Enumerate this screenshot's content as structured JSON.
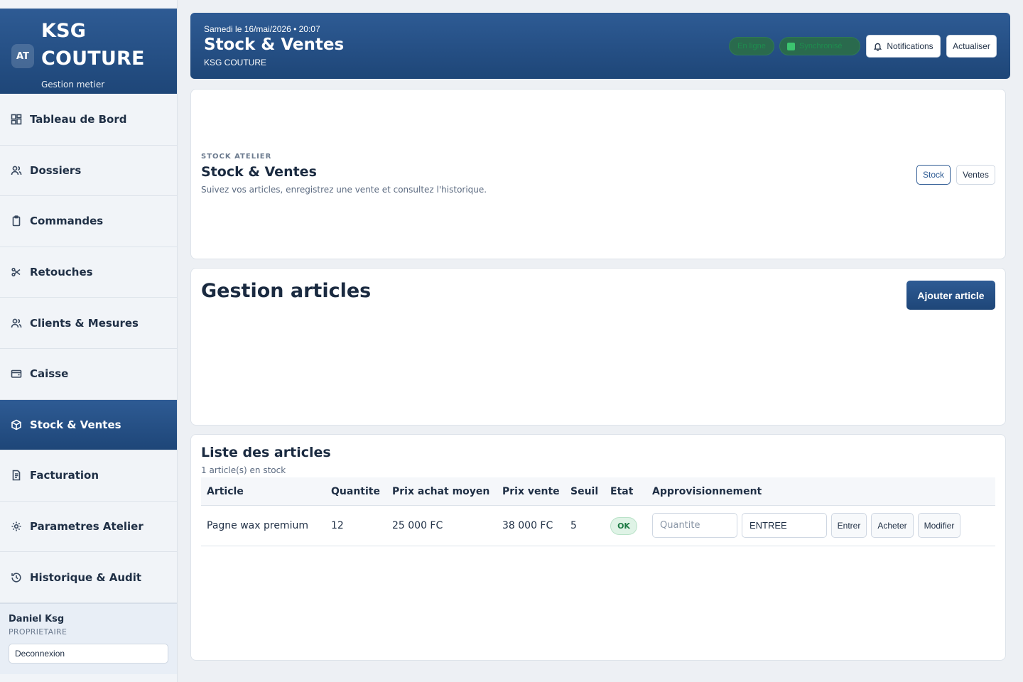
{
  "brand": {
    "badge": "AT",
    "title": "KSG COUTURE",
    "subtitle": "Gestion metier"
  },
  "nav": [
    {
      "label": "Tableau de Bord",
      "icon": "dashboard-icon"
    },
    {
      "label": "Dossiers",
      "icon": "users-icon"
    },
    {
      "label": "Commandes",
      "icon": "clipboard-icon"
    },
    {
      "label": "Retouches",
      "icon": "scissors-icon"
    },
    {
      "label": "Clients & Mesures",
      "icon": "users-icon"
    },
    {
      "label": "Caisse",
      "icon": "wallet-icon"
    },
    {
      "label": "Stock & Ventes",
      "icon": "box-icon",
      "active": true
    },
    {
      "label": "Facturation",
      "icon": "invoice-icon"
    },
    {
      "label": "Parametres Atelier",
      "icon": "gear-icon"
    },
    {
      "label": "Historique & Audit",
      "icon": "history-icon"
    }
  ],
  "user": {
    "name": "Daniel Ksg",
    "role": "PROPRIETAIRE",
    "logout": "Deconnexion"
  },
  "header": {
    "date": "Samedi le 16/mai/2026 • 20:07",
    "title": "Stock & Ventes",
    "subtitle": "KSG COUTURE",
    "status_online": "En ligne",
    "status_sync": "Synchronisé",
    "notifications": "Notifications",
    "refresh": "Actualiser"
  },
  "intro": {
    "eyebrow": "STOCK ATELIER",
    "title": "Stock & Ventes",
    "description": "Suivez vos articles, enregistrez une vente et consultez l'historique.",
    "tab_stock": "Stock",
    "tab_ventes": "Ventes"
  },
  "gestion": {
    "title": "Gestion articles",
    "add_button": "Ajouter article"
  },
  "list": {
    "title": "Liste des articles",
    "count": "1 article(s) en stock",
    "columns": [
      "Article",
      "Quantite",
      "Prix achat moyen",
      "Prix vente",
      "Seuil",
      "Etat",
      "Approvisionnement"
    ],
    "rows": [
      {
        "article": "Pagne wax premium",
        "quantite": "12",
        "prix_achat": "25 000 FC",
        "prix_vente": "38 000 FC",
        "seuil": "5",
        "etat": "OK",
        "qty_placeholder": "Quantite",
        "type_value": "ENTREE",
        "btn_enter": "Entrer",
        "btn_buy": "Acheter",
        "btn_edit": "Modifier"
      }
    ]
  },
  "colors": {
    "primary": "#2e5b94",
    "primary_dark": "#1e4678",
    "ok_bg": "#dff3e6",
    "ok_text": "#1d7a44"
  }
}
